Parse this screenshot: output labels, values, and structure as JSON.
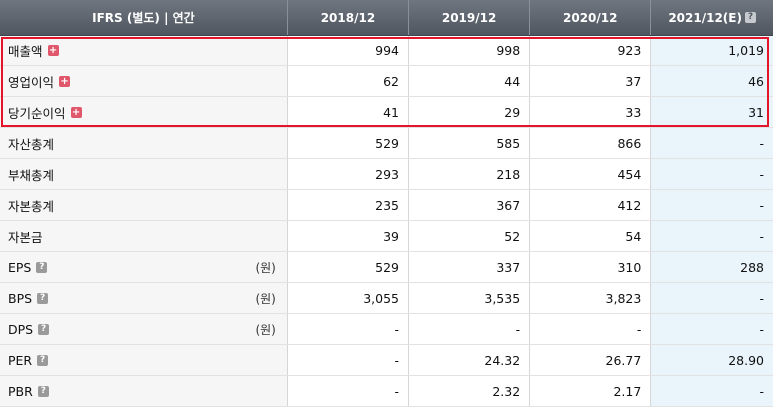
{
  "header": {
    "label": "IFRS (별도) | 연간",
    "columns": [
      "2018/12",
      "2019/12",
      "2020/12",
      "2021/12(E)"
    ],
    "help_icon": "question-icon"
  },
  "rows": [
    {
      "label": "매출액",
      "icon": "plus",
      "unit": "",
      "values": [
        "994",
        "998",
        "923",
        "1,019"
      ]
    },
    {
      "label": "영업이익",
      "icon": "plus",
      "unit": "",
      "values": [
        "62",
        "44",
        "37",
        "46"
      ]
    },
    {
      "label": "당기순이익",
      "icon": "plus",
      "unit": "",
      "values": [
        "41",
        "29",
        "33",
        "31"
      ]
    },
    {
      "label": "자산총계",
      "icon": "",
      "unit": "",
      "values": [
        "529",
        "585",
        "866",
        "-"
      ]
    },
    {
      "label": "부채총계",
      "icon": "",
      "unit": "",
      "values": [
        "293",
        "218",
        "454",
        "-"
      ]
    },
    {
      "label": "자본총계",
      "icon": "",
      "unit": "",
      "values": [
        "235",
        "367",
        "412",
        "-"
      ]
    },
    {
      "label": "자본금",
      "icon": "",
      "unit": "",
      "values": [
        "39",
        "52",
        "54",
        "-"
      ]
    },
    {
      "label": "EPS",
      "icon": "help",
      "unit": "(원)",
      "values": [
        "529",
        "337",
        "310",
        "288"
      ]
    },
    {
      "label": "BPS",
      "icon": "help",
      "unit": "(원)",
      "values": [
        "3,055",
        "3,535",
        "3,823",
        "-"
      ]
    },
    {
      "label": "DPS",
      "icon": "help",
      "unit": "(원)",
      "values": [
        "-",
        "-",
        "-",
        "-"
      ]
    },
    {
      "label": "PER",
      "icon": "help",
      "unit": "",
      "values": [
        "-",
        "24.32",
        "26.77",
        "28.90"
      ]
    },
    {
      "label": "PBR",
      "icon": "help",
      "unit": "",
      "values": [
        "-",
        "2.32",
        "2.17",
        "-"
      ]
    }
  ],
  "colors": {
    "header_bg": "#5b626c",
    "estimate_bg": "#e9f4fb",
    "highlight_border": "#e4152a",
    "plus_icon": "#e0566a"
  }
}
